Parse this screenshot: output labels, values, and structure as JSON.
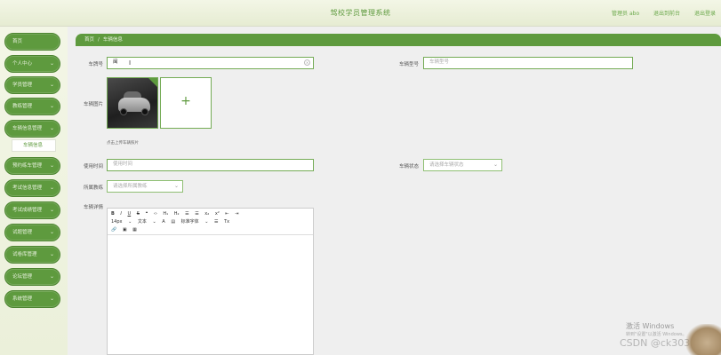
{
  "header": {
    "title": "驾校学员管理系统",
    "user_label": "管理员 abo",
    "back_home": "退出到前台",
    "logout": "退出登录"
  },
  "sidebar": {
    "items": [
      {
        "label": "首页",
        "has_arrow": false
      },
      {
        "label": "个人中心",
        "has_arrow": true
      },
      {
        "label": "学员管理",
        "has_arrow": true
      },
      {
        "label": "教练管理",
        "has_arrow": true
      },
      {
        "label": "车辆信息管理",
        "has_arrow": true
      },
      {
        "label": "预约练车管理",
        "has_arrow": true
      },
      {
        "label": "考试信息管理",
        "has_arrow": true
      },
      {
        "label": "考试成绩管理",
        "has_arrow": true
      },
      {
        "label": "试题管理",
        "has_arrow": true
      },
      {
        "label": "试卷库管理",
        "has_arrow": true
      },
      {
        "label": "论坛管理",
        "has_arrow": true
      },
      {
        "label": "系统管理",
        "has_arrow": true
      }
    ],
    "sub_item": "车辆信息"
  },
  "breadcrumb": {
    "home": "首页",
    "separator": "/",
    "current": "车辆信息"
  },
  "form": {
    "plate_label": "车牌号",
    "plate_value": "闽",
    "model_label": "车辆型号",
    "model_placeholder": "车辆型号",
    "image_label": "车辆图片",
    "image_hint": "点击上传车辆照片",
    "duration_label": "使用时间",
    "duration_placeholder": "使用时间",
    "status_label": "车辆状态",
    "status_placeholder": "请选择车辆状态",
    "coach_label": "所属教练",
    "coach_placeholder": "请选择所属教练",
    "detail_label": "车辆详情"
  },
  "editor": {
    "row1": [
      "B",
      "I",
      "U",
      "S",
      "❝",
      "‹›",
      "H₁",
      "H₂",
      "☰",
      "☰",
      "x₂",
      "x²",
      "⇤",
      "⇥"
    ],
    "row2": [
      "14px",
      "⌄",
      "文本",
      "⌄",
      "A",
      "▤",
      "标准字体",
      "⌄",
      "☰",
      "Tx"
    ],
    "row3": [
      "🔗",
      "▣",
      "▦"
    ]
  },
  "watermark": {
    "activate": "激活 Windows",
    "activate_sub": "转到\"设置\"以激活 Windows。",
    "brand": "CSDN @ck3032"
  }
}
